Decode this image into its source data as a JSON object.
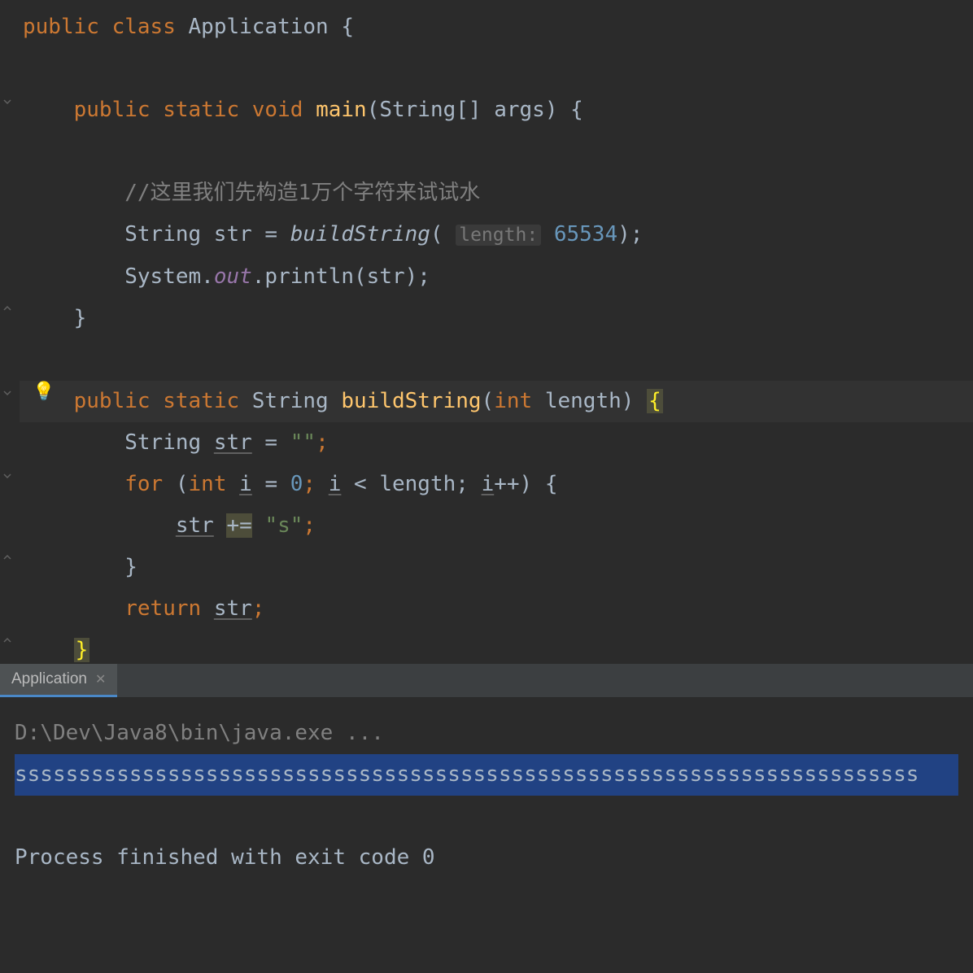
{
  "code": {
    "line1": {
      "public": "public",
      "class": "class",
      "name": "Application",
      "brace": " {"
    },
    "line2": "",
    "line3": {
      "indent": "    ",
      "public": "public",
      "static": "static",
      "void": "void",
      "main": "main",
      "params": "(String[] args) {"
    },
    "line4": "",
    "line5": {
      "indent": "        ",
      "comment": "//这里我们先构造1万个字符来试试水"
    },
    "line6": {
      "indent": "        ",
      "text1": "String str = ",
      "method": "buildString",
      "paren": "( ",
      "hint": "length:",
      "space": " ",
      "number": "65534",
      "end": ");"
    },
    "line7": {
      "indent": "        ",
      "text1": "System.",
      "out": "out",
      "text2": ".println(str);"
    },
    "line8": {
      "indent": "    ",
      "brace": "}"
    },
    "line9": "",
    "line10": {
      "indent": "    ",
      "public": "public",
      "static": "static",
      "text1": " String ",
      "method": "buildString",
      "paren1": "(",
      "int": "int",
      "text2": " length) ",
      "brace": "{"
    },
    "line11": {
      "indent": "        ",
      "text1": "String ",
      "str": "str",
      "text2": " = ",
      "string": "\"\"",
      "semi": ";"
    },
    "line12": {
      "indent": "        ",
      "for": "for",
      "paren": " (",
      "int": "int",
      "sp1": " ",
      "i1": "i",
      "text1": " = ",
      "zero": "0",
      "text2": "; ",
      "i2": "i",
      "text3": " < length; ",
      "i3": "i",
      "text4": "++) {"
    },
    "line13": {
      "indent": "            ",
      "str": "str",
      "sp": " ",
      "plus": "+=",
      "sp2": " ",
      "string": "\"s\"",
      "semi": ";"
    },
    "line14": {
      "indent": "        ",
      "brace": "}"
    },
    "line15": {
      "indent": "        ",
      "return": "return",
      "sp": " ",
      "str": "str",
      "semi": ";"
    },
    "line16": {
      "indent": "    ",
      "brace": "}"
    }
  },
  "console": {
    "tab_name": "Application",
    "command": "D:\\Dev\\Java8\\bin\\java.exe ...",
    "output_s": "sssssssssssssssssssssssssssssssssssssssssssssssssssssssssssssssssssssss",
    "exit_message": "Process finished with exit code 0"
  }
}
